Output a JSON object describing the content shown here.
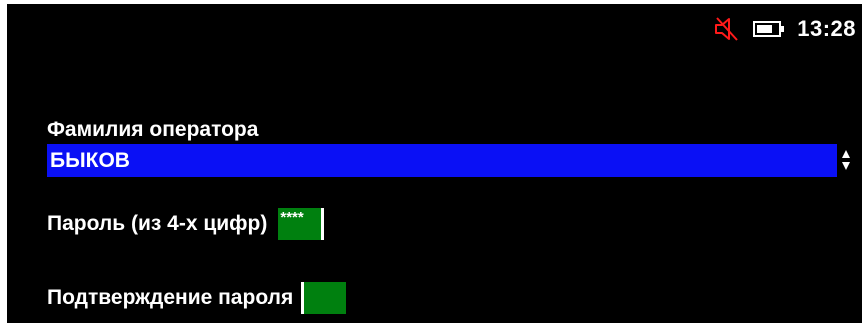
{
  "status_bar": {
    "sound": "muted",
    "icons": [
      "mute-icon",
      "battery-icon"
    ],
    "time": "13:28"
  },
  "form": {
    "operator": {
      "label": "Фамилия оператора",
      "selected": "БЫКОВ"
    },
    "password": {
      "label": "Пароль (из 4-х цифр)",
      "masked_value": "****"
    },
    "confirm": {
      "label": "Подтверждение пароля",
      "masked_value": ""
    }
  },
  "colors": {
    "background": "#000000",
    "select_highlight": "#0a10f5",
    "input_fill": "#00800f",
    "mute_icon": "#ff1a1a",
    "text": "#ffffff"
  }
}
